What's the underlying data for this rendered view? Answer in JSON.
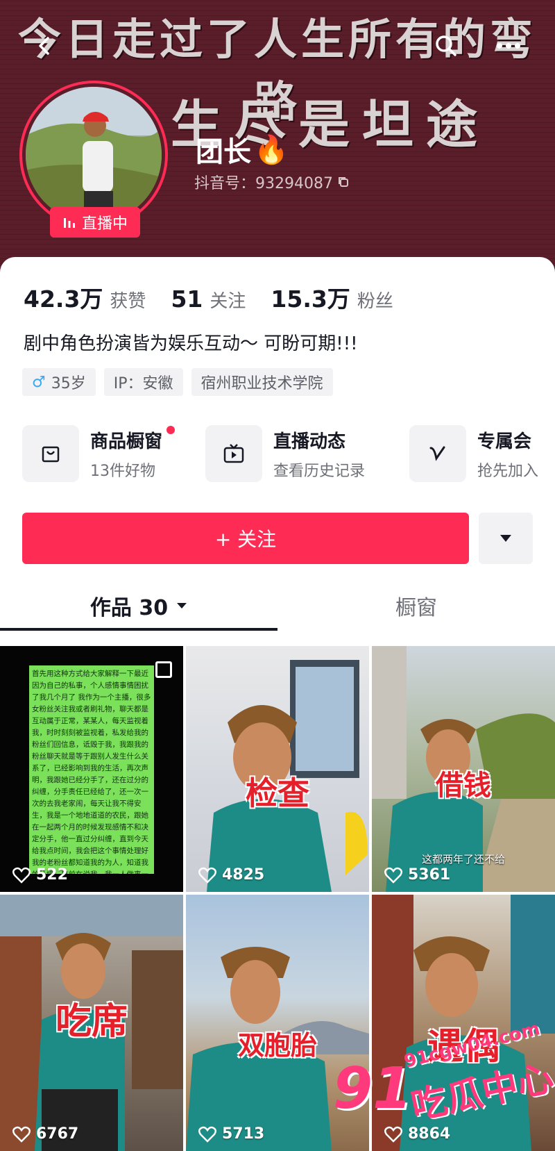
{
  "banner": {
    "line1": "今日走过了人生所有的弯路",
    "line2": "人生尽是坦途"
  },
  "profile": {
    "nickname": "团长",
    "nickname_emoji": "🔥",
    "douyin_id": "抖音号：93294087",
    "live_badge": "直播中",
    "stats": [
      {
        "value": "42.3万",
        "label": "获赞"
      },
      {
        "value": "51",
        "label": "关注"
      },
      {
        "value": "15.3万",
        "label": "粉丝"
      }
    ],
    "bio": "剧中角色扮演皆为娱乐互动～ 可盼可期!!!",
    "tags": {
      "age": "35岁",
      "ip": "IP：安徽",
      "school": "宿州职业技术学院"
    }
  },
  "shortcuts": [
    {
      "title": "商品橱窗",
      "sub": "13件好物"
    },
    {
      "title": "直播动态",
      "sub": "查看历史记录"
    },
    {
      "title": "专属会",
      "sub": "抢先加入"
    }
  ],
  "actions": {
    "follow": "+ 关注"
  },
  "tabs": {
    "works": "作品 30",
    "window": "橱窗"
  },
  "videos": [
    {
      "likes": "522",
      "caption": "",
      "sub": ""
    },
    {
      "likes": "4825",
      "caption": "检查",
      "sub": ""
    },
    {
      "likes": "5361",
      "caption": "借钱",
      "sub": "这都两年了还不给"
    },
    {
      "likes": "6767",
      "caption": "吃席",
      "sub": ""
    },
    {
      "likes": "5713",
      "caption": "双胞胎",
      "sub": ""
    },
    {
      "likes": "8864",
      "caption": "遇偶",
      "sub": ""
    }
  ],
  "chat_text": "首先用这种方式给大家解释一下最近因为自己的私事，个人感情事情困扰了我几个月了 我作为一个主播，很多女粉丝关注我或者刷礼物，聊天都是互动属于正常，某某人，每天监视着我，时时刻刻被监视着，私发给我的粉丝们回信息，诋毁于我，我跟我的粉丝聊天就是等于跟别人发生什么关系了，已经影响到我的生活，再次声明，我跟她已经分手了，还在过分的纠缠，分手责任已经给了，还一次一次的去我老家闹，每天让我不得安生，我是一个地地道道的农民，跟她在一起两个月的时候发现感情不和决定分手，他一直过分纠缠，直到今天 给我点时间，我会把这个事情处理好 我的老粉丝都知道我的为人，知道我的处境，目前在说我，我一人做事一人当，没做就是没做 这也是我个人的私事，跟他也无",
  "watermark": {
    "brand": "91",
    "name": "吃瓜中心",
    "url": "91cgw04.com"
  },
  "colors": {
    "accent": "#fe2c55",
    "banner_bg": "#5a1d2a",
    "watermark": "#ff3a7c"
  }
}
